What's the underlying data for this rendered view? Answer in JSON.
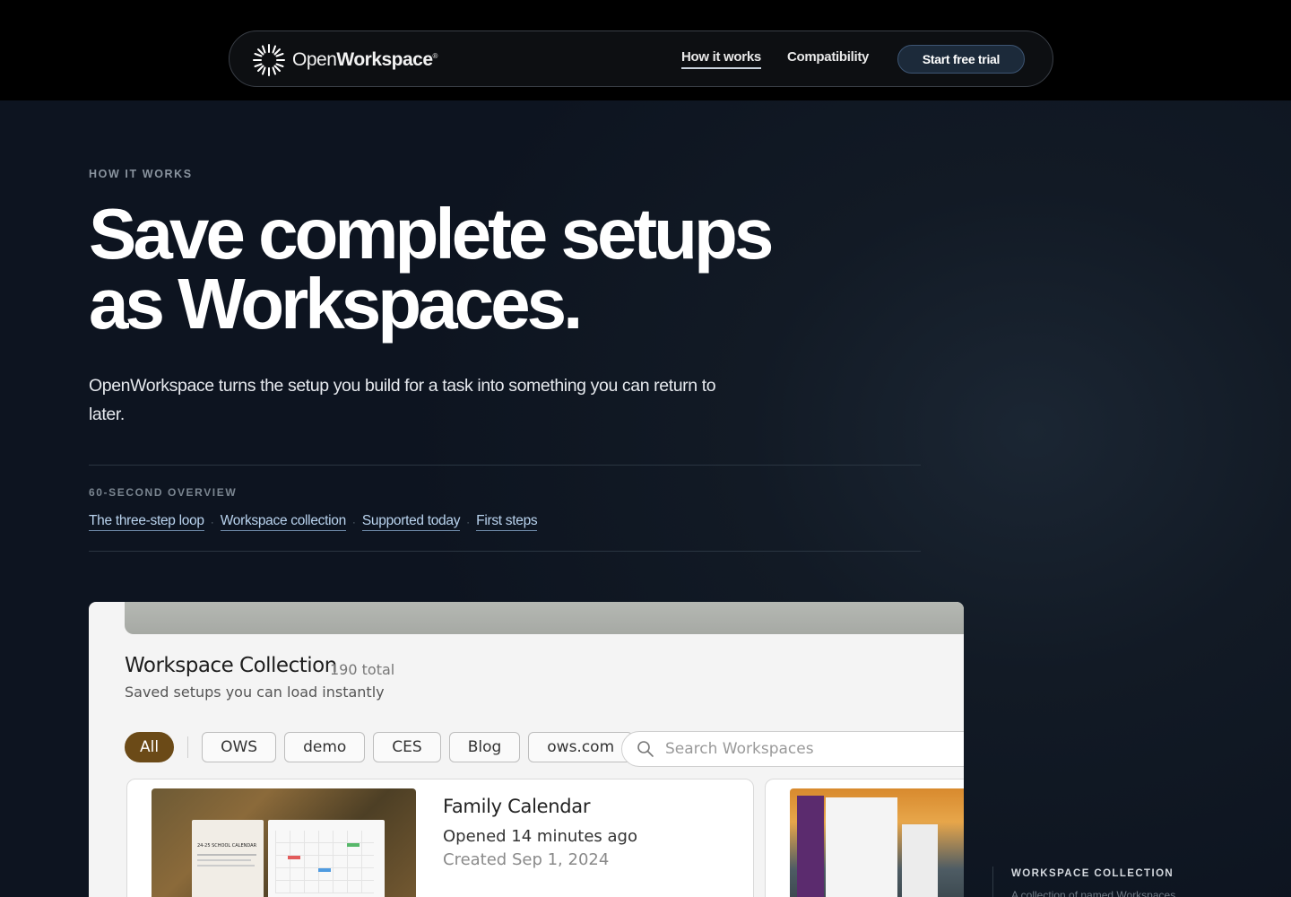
{
  "nav": {
    "brand_light": "Open",
    "brand_bold": "Workspace",
    "brand_mark": "®",
    "links": [
      "How it works",
      "Compatibility"
    ],
    "cta": "Start free trial"
  },
  "hero": {
    "eyebrow": "HOW IT WORKS",
    "title_line1": "Save complete setups",
    "title_line2": "as Workspaces.",
    "subtitle": "OpenWorkspace turns the setup you build for a task into something you can return to later."
  },
  "overview": {
    "label": "60-SECOND OVERVIEW",
    "links": [
      "The three-step loop",
      "Workspace collection",
      "Supported today",
      "First steps"
    ],
    "separator": "·"
  },
  "app": {
    "title": "Workspace Collection",
    "count": "190 total",
    "subtitle": "Saved setups you can load instantly",
    "filters": [
      "All",
      "OWS",
      "demo",
      "CES",
      "Blog",
      "ows.com"
    ],
    "search_placeholder": "Search Workspaces",
    "cards": [
      {
        "title": "Family Calendar",
        "opened": "Opened 14 minutes ago",
        "created": "Created Sep 1, 2024",
        "thumb_caption": "24-25 SCHOOL CALENDAR"
      }
    ]
  },
  "side_tag": {
    "title": "WORKSPACE COLLECTION",
    "subtitle": "A collection of named Workspaces"
  },
  "colors": {
    "page_bg": "#121a25",
    "topbar_bg": "#000000",
    "accent_link": "#b9d3ee",
    "filter_active": "#6b4a17",
    "cta_bg": "#1c2a3a"
  }
}
